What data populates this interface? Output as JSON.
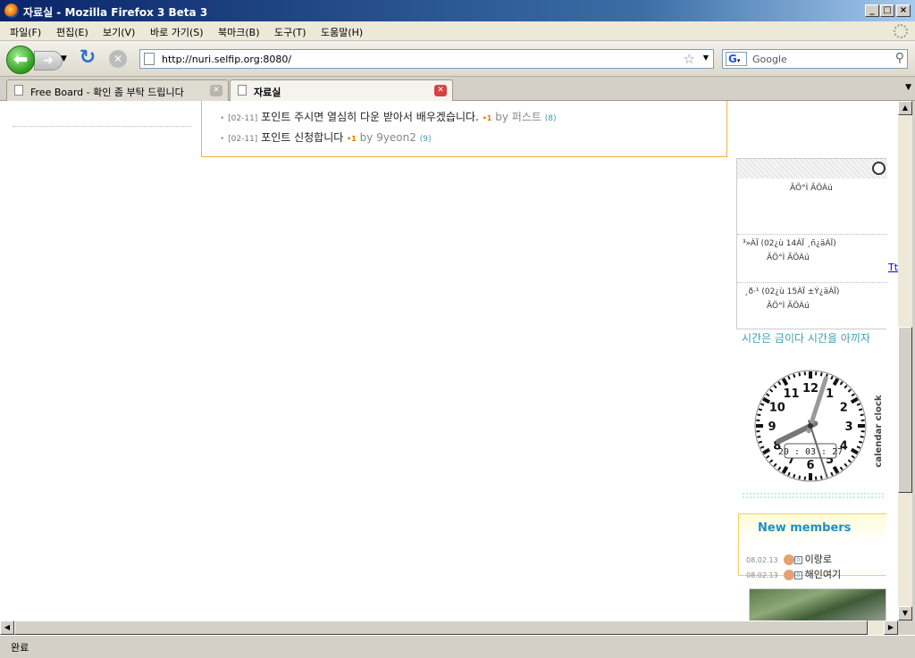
{
  "window": {
    "title": "자료실 - Mozilla Firefox 3 Beta 3"
  },
  "menu": [
    "파일(F)",
    "편집(E)",
    "보기(V)",
    "바로 가기(S)",
    "북마크(B)",
    "도구(T)",
    "도움말(H)"
  ],
  "nav": {
    "url": "http://nuri.selfip.org:8080/",
    "search_placeholder": "Google",
    "search_engine_letter": "G"
  },
  "tabs": [
    {
      "label": "Free Board - 확인 좀 부탁 드립니다",
      "active": false
    },
    {
      "label": "자료실",
      "active": true
    }
  ],
  "posts": [
    {
      "date": "[02-11]",
      "title": "포인트 주시면 열심히 다운 받아서 배우겠습니다.",
      "author": "퍼스트",
      "comments": "(8)"
    },
    {
      "date": "[02-11]",
      "title": "포인트 신청합니다",
      "author": "9yeon2",
      "comments": "(9)"
    }
  ],
  "by_label": "by",
  "new_marker": "•1",
  "widget": {
    "line1": "ÃÖ°Ì  ÃÖÀú",
    "entry2_title": "³»ÀÏ (02¿ù 14ÀÏ ¸ñ¿äÀÏ)",
    "entry2_values": "ÃÖ°Ì  ÃÖÀú",
    "entry3_title": "¸ð·¹ (02¿ù 15ÀÏ ±Ý¿äÀÏ)",
    "entry3_values": "ÃÖ°Ì  ÃÖÀú"
  },
  "side_link": "Tt",
  "quote": "시간은 금이다  시간을 아끼자",
  "clock": {
    "time": "20 : 03 : 27",
    "side_text": "calendar clock",
    "numbers": [
      "12",
      "1",
      "2",
      "3",
      "4",
      "5",
      "6",
      "7",
      "8",
      "9",
      "10",
      "11"
    ],
    "hour_angle": 244,
    "minute_angle": 18,
    "second_angle": 162
  },
  "members": {
    "title": "New members",
    "rows": [
      {
        "date": "08.02.13",
        "level": "0",
        "name": "이랑로"
      },
      {
        "date": "08.02.13",
        "level": "0",
        "name": "해인여기"
      }
    ]
  },
  "status": "완료"
}
